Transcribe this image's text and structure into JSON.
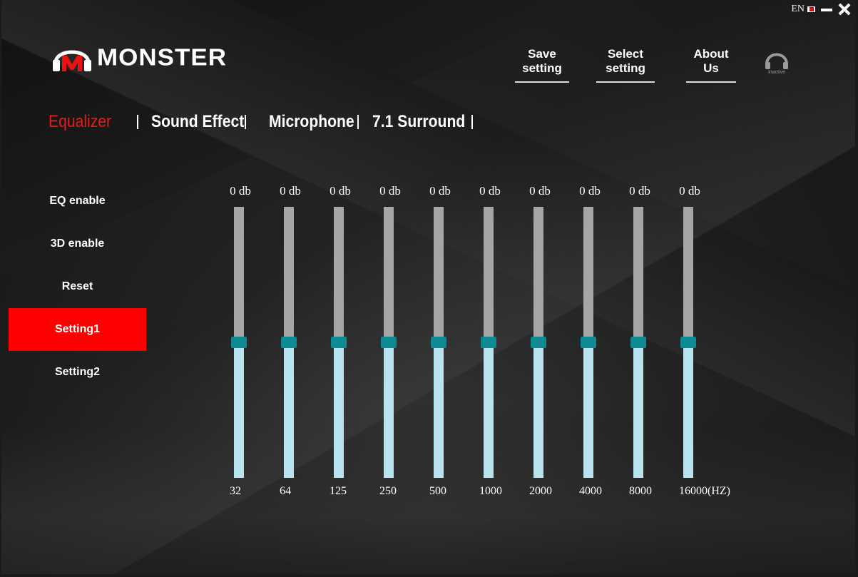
{
  "window": {
    "language": "EN"
  },
  "logo": {
    "brand": "MONSTER"
  },
  "top_nav": [
    {
      "label": "Save setting",
      "name": "save-setting-link"
    },
    {
      "label": "Select setting",
      "name": "select-setting-link"
    },
    {
      "label": "About Us",
      "name": "about-us-link"
    }
  ],
  "device_status": "Inactive",
  "tabs": [
    {
      "label": "Equalizer",
      "active": true
    },
    {
      "label": "Sound Effect",
      "active": false
    },
    {
      "label": "Microphone",
      "active": false
    },
    {
      "label": "7.1 Surround",
      "active": false
    }
  ],
  "sidebar": [
    {
      "label": "EQ enable",
      "active": false
    },
    {
      "label": "3D enable",
      "active": false
    },
    {
      "label": "Reset",
      "active": false
    },
    {
      "label": "Setting1",
      "active": true
    },
    {
      "label": "Setting2",
      "active": false
    }
  ],
  "equalizer": {
    "bands": [
      {
        "freq": "32",
        "gain_label": "0 db",
        "gain": 0
      },
      {
        "freq": "64",
        "gain_label": "0 db",
        "gain": 0
      },
      {
        "freq": "125",
        "gain_label": "0 db",
        "gain": 0
      },
      {
        "freq": "250",
        "gain_label": "0 db",
        "gain": 0
      },
      {
        "freq": "500",
        "gain_label": "0 db",
        "gain": 0
      },
      {
        "freq": "1000",
        "gain_label": "0 db",
        "gain": 0
      },
      {
        "freq": "2000",
        "gain_label": "0 db",
        "gain": 0
      },
      {
        "freq": "4000",
        "gain_label": "0 db",
        "gain": 0
      },
      {
        "freq": "8000",
        "gain_label": "0 db",
        "gain": 0
      },
      {
        "freq": "16000(HZ)",
        "gain_label": "0 db",
        "gain": 0
      }
    ],
    "slider_level": 0.5
  },
  "colors": {
    "accent_red": "#ff0000",
    "tab_active": "#e41b1b",
    "thumb": "#0d8a92",
    "fill": "#b8e3ef",
    "track": "#a6a6a6"
  }
}
